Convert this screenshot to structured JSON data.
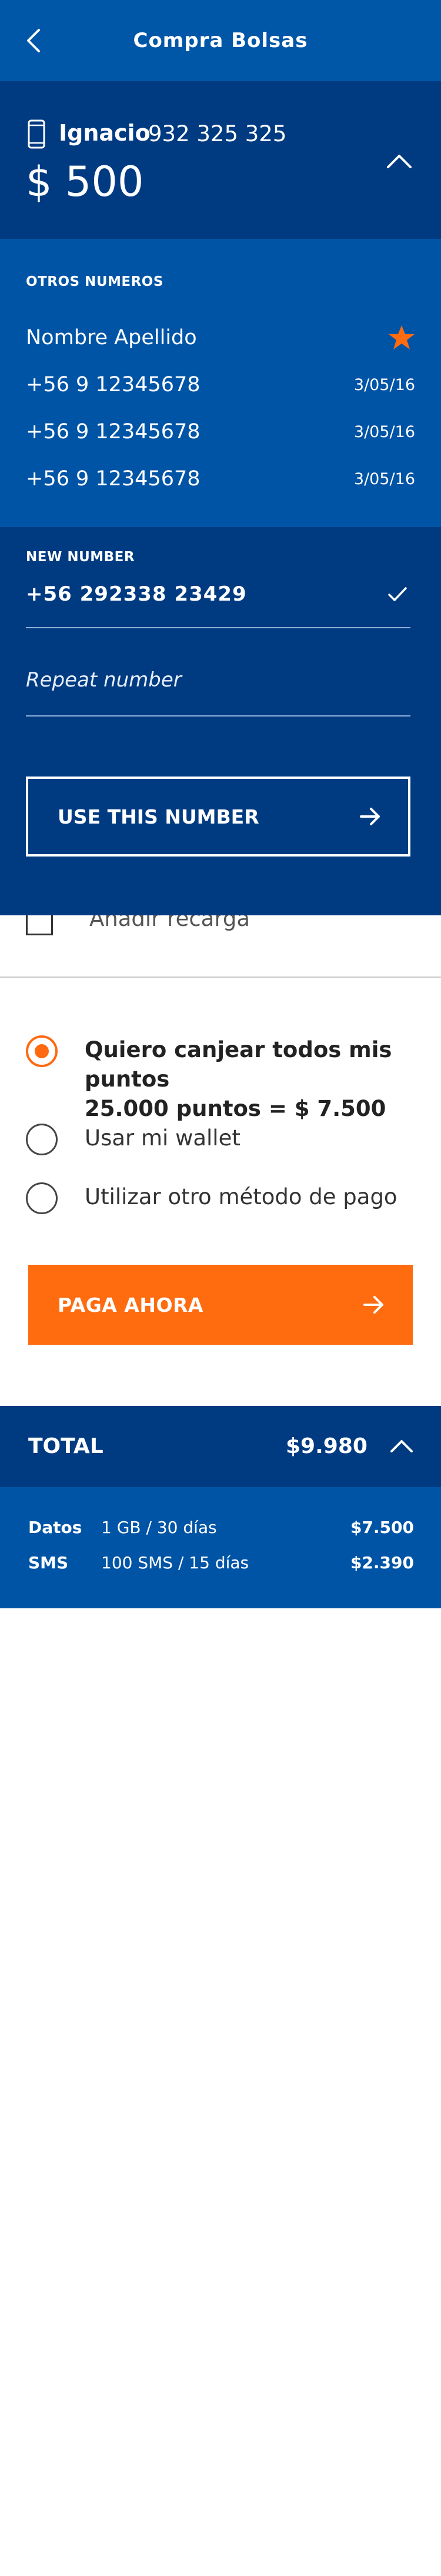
{
  "header": {
    "title": "Compra Bolsas",
    "back_icon": "chevron-left-icon"
  },
  "account": {
    "name": "Ignacio",
    "number": "932 325 325",
    "amount": "$ 500"
  },
  "others": {
    "label": "OTROS NUMEROS",
    "rows": [
      {
        "name": "Nombre Apellido",
        "favorite": true
      },
      {
        "name": "+56 9 12345678",
        "date": "3/05/16"
      },
      {
        "name": "+56 9 12345678",
        "date": "3/05/16"
      },
      {
        "name": "+56 9 12345678",
        "date": "3/05/16"
      }
    ]
  },
  "new_number": {
    "label": "NEW NUMBER",
    "value": "+56 292338 23429",
    "repeat_placeholder": "Repeat number",
    "use_button": "USE THIS NUMBER"
  },
  "recarga": {
    "label": "Añadir recarga"
  },
  "payment": {
    "options": [
      {
        "line1": "Quiero canjear todos mis puntos",
        "line2": "25.000 puntos = $ 7.500",
        "selected": true
      },
      {
        "line1": "Usar mi wallet",
        "selected": false
      },
      {
        "line1": "Utilizar otro método de pago",
        "selected": false
      }
    ],
    "pay_button": "PAGA AHORA"
  },
  "total": {
    "label": "TOTAL",
    "value": "$9.980"
  },
  "detail": [
    {
      "k": "Datos",
      "d": "1 GB / 30 días",
      "v": "$7.500"
    },
    {
      "k": "SMS",
      "d": "100 SMS / 15 días",
      "v": "$2.390"
    }
  ],
  "colors": {
    "header": "#0057a8",
    "dark_blue": "#003b82",
    "mid_blue": "#0054a6",
    "accent": "#ff6b0f"
  }
}
